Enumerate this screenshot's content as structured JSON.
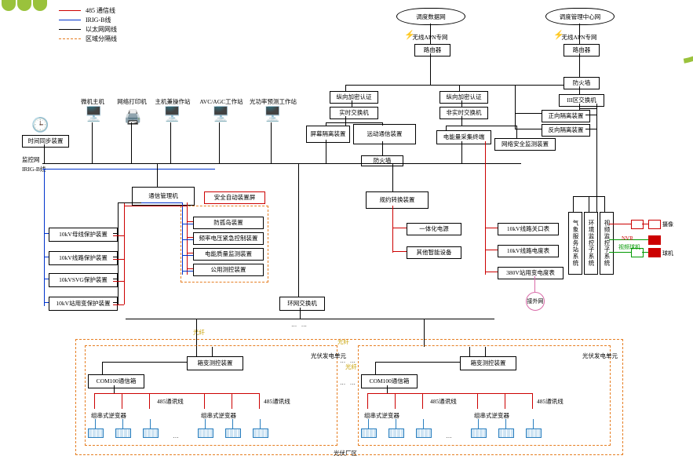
{
  "legend": [
    {
      "label": "485 通信线",
      "color": "#cc0000",
      "dash": false
    },
    {
      "label": "IRIG-B线",
      "color": "#0033cc",
      "dash": false
    },
    {
      "label": "以太网网线",
      "color": "#000000",
      "dash": false
    },
    {
      "label": "区域分隔线",
      "color": "#e67e22",
      "dash": true
    }
  ],
  "clouds": {
    "left": "调度数据网",
    "right": "调度管理中心网"
  },
  "cloud_sub": {
    "left": "无线APN专网",
    "right": "无线APN专网"
  },
  "top_ws": [
    {
      "label": "微机主机"
    },
    {
      "label": "网络打印机"
    },
    {
      "label": "主机兼操作站"
    },
    {
      "label": "AVC/AGC工作站"
    },
    {
      "label": "光功率预测工作站"
    }
  ],
  "clock_box": "时间同步装置",
  "bus_labels": {
    "top": "监控网",
    "bot": "IRIG-B线"
  },
  "comm_mgr": "通信管理机",
  "safe_auto_box": "安全自动装置屏",
  "safe_auto_items": [
    "防孤岛装置",
    "频率电压紧急控制装置",
    "电能质量监测装置",
    "公用测控装置"
  ],
  "left_prot": [
    "10kV母线保护装置",
    "10kV线路保护装置",
    "10kVSVG保护装置",
    "10kV站用变保护装置"
  ],
  "ring_switch": "环网交换机",
  "mid_top": {
    "auth": "纵向加密认证",
    "rt_switch": "实时交换机",
    "screen": "屏幕隔离装置",
    "remote": "远动通信装置",
    "fw": "防火墙",
    "convert": "规约转换装置",
    "conv_items": [
      "一体化电源",
      "其他智能设备"
    ]
  },
  "right_top": {
    "router": "路由器",
    "auth": "纵向加密认证",
    "nonrt": "非实时交换机",
    "meter_term": "电能量采集终端",
    "net_safe": "网络安全监测装置",
    "fwd_iso": "正向隔离装置",
    "rev_iso": "反向隔离装置",
    "router2": "路由器",
    "fw2": "防火墙",
    "sw3": "III区交换机",
    "right_list": [
      "10kV线路关口表",
      "10kV线路电度表",
      "380V站用变电度表"
    ]
  },
  "right_sys": [
    "气象服务站系统",
    "环境监控子系统",
    "视频监控子系统"
  ],
  "right_icons": {
    "a": "摄像",
    "b": "NVR",
    "c": "视频球机",
    "d": "球机"
  },
  "pcircle": "接外网",
  "fiber": "光纤",
  "pv_unit": "光伏发电单元",
  "pv": {
    "box_title": "箱变测控装置",
    "com": "COM100通信箱",
    "inv_l": "组串式逆变器",
    "note485": "485通讯线"
  },
  "pv_area": "光伏厂区",
  "chart_data": null
}
